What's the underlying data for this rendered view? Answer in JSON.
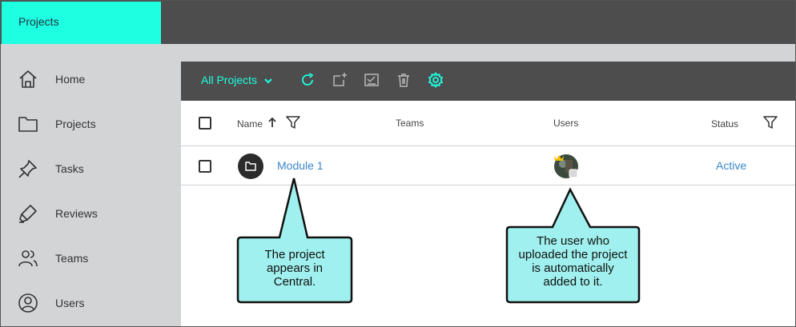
{
  "topbar": {
    "active_tab": "Projects"
  },
  "sidebar": {
    "items": [
      {
        "label": "Home",
        "icon": "home-icon"
      },
      {
        "label": "Projects",
        "icon": "folder-icon"
      },
      {
        "label": "Tasks",
        "icon": "pin-icon"
      },
      {
        "label": "Reviews",
        "icon": "highlighter-icon"
      },
      {
        "label": "Teams",
        "icon": "people-icon"
      },
      {
        "label": "Users",
        "icon": "user-circle-icon"
      }
    ]
  },
  "toolbar": {
    "filter_label": "All Projects",
    "icons": [
      "refresh-icon",
      "add-project-icon",
      "checklist-icon",
      "trash-icon",
      "gear-icon"
    ]
  },
  "table": {
    "headers": {
      "name": "Name",
      "teams": "Teams",
      "users": "Users",
      "status": "Status"
    },
    "rows": [
      {
        "name": "Module 1",
        "status": "Active"
      }
    ]
  },
  "callouts": {
    "project": [
      "The project",
      "appears in",
      "Central."
    ],
    "user": [
      "The user who",
      "uploaded the project",
      "is automatically",
      "added to it."
    ]
  },
  "colors": {
    "accent": "#1dffe0",
    "toolbar_bg": "#4d4d4d",
    "sidebar_bg": "#d3d4d6",
    "link": "#3a87c8",
    "callout_fill": "#9ff0ee"
  }
}
